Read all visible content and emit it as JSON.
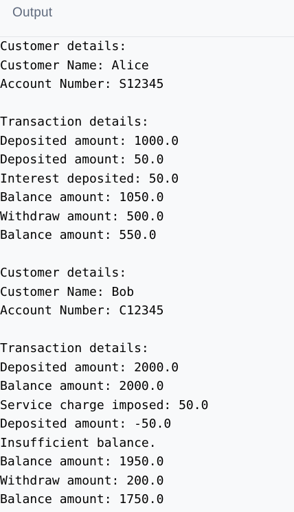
{
  "header": {
    "title": "Output"
  },
  "output": {
    "lines": [
      "Customer details:",
      "Customer Name: Alice",
      "Account Number: S12345",
      "",
      "Transaction details:",
      "Deposited amount: 1000.0",
      "Deposited amount: 50.0",
      "Interest deposited: 50.0",
      "Balance amount: 1050.0",
      "Withdraw amount: 500.0",
      "Balance amount: 550.0",
      "",
      "Customer details:",
      "Customer Name: Bob",
      "Account Number: C12345",
      "",
      "Transaction details:",
      "Deposited amount: 2000.0",
      "Balance amount: 2000.0",
      "Service charge imposed: 50.0",
      "Deposited amount: -50.0",
      "Insufficient balance.",
      "Balance amount: 1950.0",
      "Withdraw amount: 200.0",
      "Balance amount: 1750.0"
    ]
  }
}
